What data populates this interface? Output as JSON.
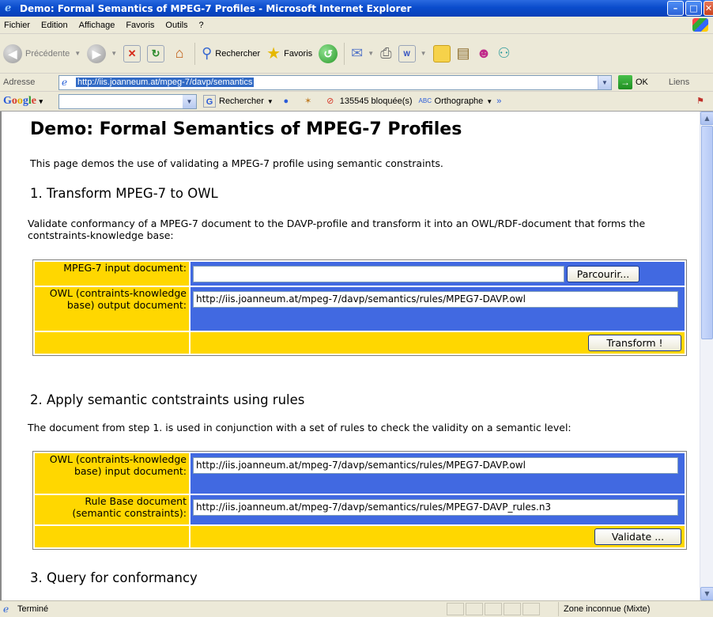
{
  "window": {
    "title": "Demo: Formal Semantics of MPEG-7 Profiles - Microsoft Internet Explorer"
  },
  "menu": [
    "Fichier",
    "Edition",
    "Affichage",
    "Favoris",
    "Outils",
    "?"
  ],
  "toolbar": {
    "back_label": "Précédente",
    "search_label": "Rechercher",
    "favorites_label": "Favoris"
  },
  "address": {
    "label": "Adresse",
    "url": "http://iis.joanneum.at/mpeg-7/davp/semantics",
    "go_label": "OK",
    "links_label": "Liens"
  },
  "googlebar": {
    "logo": "Google",
    "search_label": "Rechercher",
    "blocked_label": "135545 bloquée(s)",
    "spell_label": "Orthographe"
  },
  "page": {
    "title": "Demo: Formal Semantics of MPEG-7 Profiles",
    "intro": "This page demos the use of validating a MPEG-7 profile using semantic constraints.",
    "section1": {
      "heading": "1. Transform MPEG-7 to OWL",
      "description": "Validate conformancy of a MPEG-7 document to the DAVP-profile and transform it into an OWL/RDF-document that forms the contstraints-knowledge base:",
      "input_label": "MPEG-7 input document:",
      "input_value": "",
      "browse_label": "Parcourir...",
      "output_label": "OWL (contraints-knowledge base) output document:",
      "output_value": "http://iis.joanneum.at/mpeg-7/davp/semantics/rules/MPEG7-DAVP.owl",
      "transform_label": "Transform !"
    },
    "section2": {
      "heading": "2. Apply semantic contstraints using rules",
      "description": "The document from step 1. is used in conjunction with a set of rules to check the validity on a semantic level:",
      "owl_label": "OWL (contraints-knowledge base) input document:",
      "owl_value": "http://iis.joanneum.at/mpeg-7/davp/semantics/rules/MPEG7-DAVP.owl",
      "rules_label": "Rule Base document (semantic constraints):",
      "rules_value": "http://iis.joanneum.at/mpeg-7/davp/semantics/rules/MPEG7-DAVP_rules.n3",
      "validate_label": "Validate ..."
    },
    "section3": {
      "heading": "3. Query for conformancy"
    }
  },
  "status": {
    "text": "Terminé",
    "zone": "Zone inconnue (Mixte)"
  }
}
